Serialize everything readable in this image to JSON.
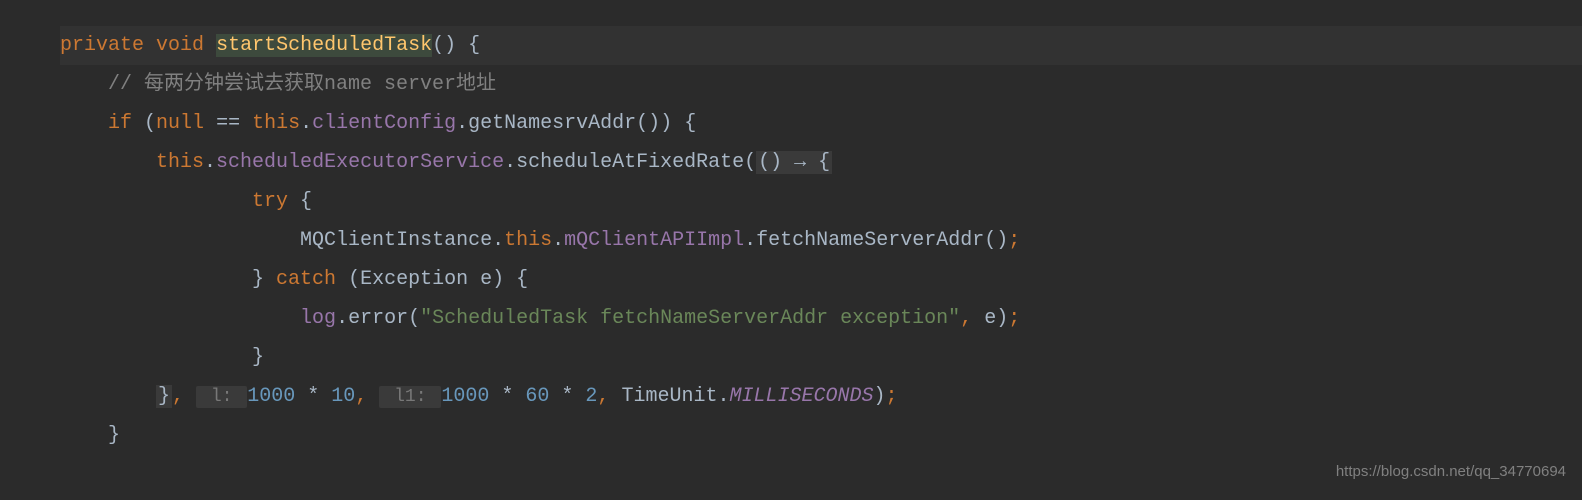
{
  "code": {
    "line1": {
      "kw1": "private",
      "kw2": "void",
      "method": "startScheduledTask",
      "parens": "()",
      "brace": " {"
    },
    "line2": {
      "comment": "// 每两分钟尝试去获取name server地址"
    },
    "line3": {
      "kw_if": "if ",
      "open": "(",
      "kw_null": "null",
      "op": " == ",
      "kw_this": "this",
      "dot1": ".",
      "field1": "clientConfig",
      "dot2": ".",
      "method1": "getNamesrvAddr()) {"
    },
    "line4": {
      "kw_this": "this",
      "dot1": ".",
      "field1": "scheduledExecutorService",
      "dot2": ".",
      "method1": "scheduleAtFixedRate(",
      "lambda": "() → {"
    },
    "line5": {
      "kw_try": "try",
      "brace": " {"
    },
    "line6": {
      "class1": "MQClientInstance.",
      "kw_this": "this",
      "dot1": ".",
      "field1": "mQClientAPIImpl",
      "dot2": ".",
      "method1": "fetchNameServerAddr()",
      "semi": ";"
    },
    "line7": {
      "close_brace": "} ",
      "kw_catch": "catch",
      "parens": " (Exception e) {"
    },
    "line8": {
      "field1": "log",
      "dot1": ".",
      "method1": "error(",
      "string1": "\"ScheduledTask fetchNameServerAddr exception\"",
      "comma": ", ",
      "arg": "e)",
      "semi": ";"
    },
    "line9": {
      "close_brace": "}"
    },
    "line10": {
      "close": "}",
      "comma1": ", ",
      "hint1": " l: ",
      "num1": "1000",
      "op1": " * ",
      "num2": "10",
      "comma2": ", ",
      "hint2": " l1: ",
      "num3": "1000",
      "op2": " * ",
      "num4": "60",
      "op3": " * ",
      "num5": "2",
      "comma3": ", ",
      "class1": "TimeUnit.",
      "const1": "MILLISECONDS",
      "close2": ")",
      "semi": ";"
    },
    "line11": {
      "close_brace": "}"
    }
  },
  "watermark": "https://blog.csdn.net/qq_34770694"
}
